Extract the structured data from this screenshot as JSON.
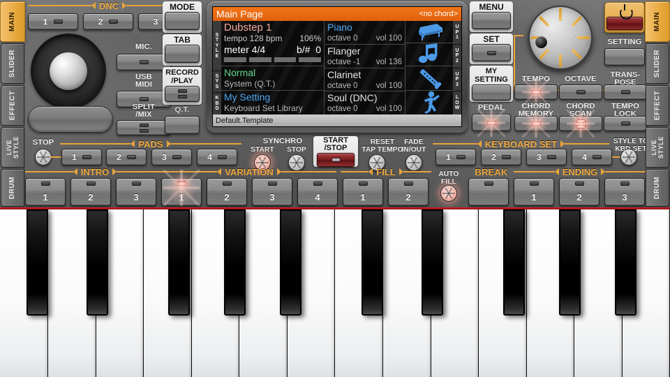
{
  "side_tabs": {
    "items": [
      "MAIN",
      "SLIDER",
      "EFFECT",
      "LIVE STYLE",
      "DRUM"
    ],
    "active": "MAIN"
  },
  "dnc": {
    "group_label": "DNC",
    "buttons": [
      "1",
      "2",
      "3"
    ]
  },
  "left_column": {
    "mic_label": "MIC.",
    "usb_midi_label": "USB\nMIDI",
    "split_mix_label": "SPLIT\n/MIX"
  },
  "mode_column": {
    "mode_label": "MODE",
    "tab_label": "TAB",
    "record_play_label": "RECORD\n/PLAY",
    "qt_label": "Q.T."
  },
  "display": {
    "title": "Main Page",
    "chord": "<no chord>",
    "rails_left": [
      "STYLE",
      "SYS",
      "KBD"
    ],
    "rails_right": [
      "UP1",
      "UP2",
      "UP3",
      "LOW"
    ],
    "style": {
      "name": "Dubstep 1",
      "tempo_label": "tempo 128 bpm",
      "tempo_percent": "106%",
      "meter_label": "meter 4/4",
      "key_label": "b/#",
      "key_value": "0"
    },
    "system": {
      "name": "Normal",
      "sub": "System (Q.T.)"
    },
    "kbd": {
      "name": "My Setting",
      "sub": "Keyboard Set Library"
    },
    "tracks": [
      {
        "name": "Piano",
        "octave": "octave  0",
        "vol": "vol 100",
        "icon": "grand-piano-icon"
      },
      {
        "name": "Flanger",
        "octave": "octave -1",
        "vol": "vol 136",
        "icon": "music-note-icon"
      },
      {
        "name": "Clarinet",
        "octave": "octave  0",
        "vol": "vol 100",
        "icon": "clarinet-icon"
      },
      {
        "name": "Soul (DNC)",
        "octave": "octave  0",
        "vol": "vol 100",
        "icon": "dancer-icon"
      }
    ],
    "footer": "Default.Template"
  },
  "right_column": {
    "menu_label": "MENU",
    "set_label": "SET",
    "my_setting_label": "MY\nSETTING",
    "pedal_label": "PEDAL",
    "setting_label": "SETTING",
    "power_icon": "power-icon"
  },
  "function_buttons": {
    "tempo": "TEMPO",
    "octave": "OCTAVE",
    "transpose": "TRANS-\nPOSE",
    "chord_memory": "CHORD\nMEMORY",
    "chord_scan": "CHORD\nSCAN",
    "tempo_lock": "TEMPO\nLOCK"
  },
  "transport": {
    "stop_label": "STOP",
    "pads_group": "PADS",
    "pads": [
      "1",
      "2",
      "3",
      "4"
    ],
    "synchro_label": "SYNCHRO",
    "synchro_start": "START",
    "synchro_stop": "STOP",
    "start_stop": "START\n/STOP",
    "reset_tap_tempo": "RESET\nTAP TEMPO",
    "fade_in_out": "FADE\nIN/OUT",
    "keyboard_set_group": "KEYBOARD SET",
    "keyboard_sets": [
      "1",
      "2",
      "3",
      "4"
    ],
    "style_to_kbd_set": "STYLE TO\nKBD SET"
  },
  "style_row": {
    "intro_group": "INTRO",
    "intro": [
      "1",
      "2",
      "3"
    ],
    "variation_group": "VARIATION",
    "variation": [
      "1",
      "2",
      "3",
      "4"
    ],
    "fill_group": "FILL",
    "fill": [
      "1",
      "2"
    ],
    "auto_fill": "AUTO\nFILL",
    "break_group": "BREAK",
    "ending_group": "ENDING",
    "ending": [
      "1",
      "2",
      "3"
    ]
  },
  "colors": {
    "accent_orange": "#e8a33c",
    "lcd_title_bar": "#f2751a",
    "led_red": "#ff9a8c",
    "panel_gray": "#656565"
  },
  "keyboard": {
    "white_key_count": 14,
    "octaves": 2,
    "notes": [
      "C",
      "D",
      "E",
      "F",
      "G",
      "A",
      "B",
      "C",
      "D",
      "E",
      "F",
      "G",
      "A",
      "B"
    ]
  }
}
